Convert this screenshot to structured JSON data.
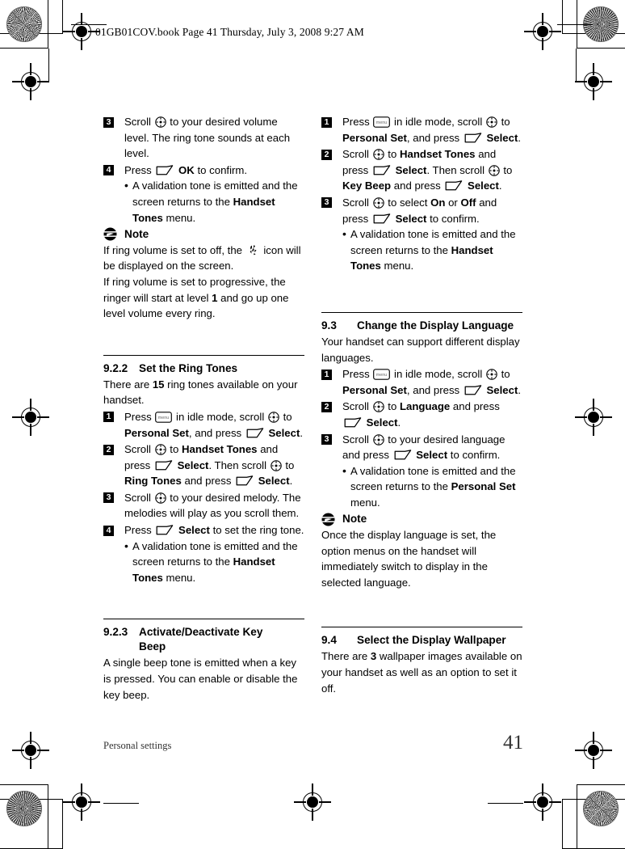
{
  "header": {
    "text": "01GB01COV.book  Page 41  Thursday, July 3, 2008  9:27 AM"
  },
  "footer": {
    "section_label": "Personal settings",
    "page_number": "41"
  },
  "icons": {
    "scroll": "scroll-wheel-icon",
    "softkey": "soft-key-icon",
    "menu_key": "menu-key-icon",
    "menu_key_label": "menu",
    "note": "note-icon",
    "ring_off": "ring-off-icon"
  },
  "left_column": {
    "steps_volume": [
      {
        "number": "3",
        "parts": [
          {
            "t": "text",
            "v": "Scroll "
          },
          {
            "t": "icon",
            "v": "scroll"
          },
          {
            "t": "text",
            "v": " to your desired volume level. The ring tone sounds at each level."
          }
        ]
      },
      {
        "number": "4",
        "parts": [
          {
            "t": "text",
            "v": "Press "
          },
          {
            "t": "icon",
            "v": "softkey"
          },
          {
            "t": "bold",
            "v": " OK"
          },
          {
            "t": "text",
            "v": " to confirm."
          }
        ]
      }
    ],
    "bullet_volume": [
      {
        "t": "text",
        "v": "A validation tone is emitted and the screen returns to the "
      },
      {
        "t": "bold",
        "v": "Handset Tones"
      },
      {
        "t": "text",
        "v": " menu."
      }
    ],
    "note": {
      "label": "Note",
      "line1_a": "If ring volume is set to off, the ",
      "line1_b": " icon will be displayed on the screen.",
      "line2_a": "If ring volume is set to progressive, the ringer will start at level ",
      "line2_b": "1",
      "line2_c": " and go up one level volume every ring."
    },
    "section_922": {
      "number": "9.2.2",
      "title": "Set the Ring Tones",
      "intro_a": "There are ",
      "intro_b": "15",
      "intro_c": " ring tones available on your handset.",
      "steps": [
        {
          "number": "1",
          "parts": [
            {
              "t": "text",
              "v": "Press "
            },
            {
              "t": "icon",
              "v": "menu_key"
            },
            {
              "t": "text",
              "v": " in idle mode, scroll "
            },
            {
              "t": "icon",
              "v": "scroll"
            },
            {
              "t": "text",
              "v": " to "
            },
            {
              "t": "bold",
              "v": "Personal Set"
            },
            {
              "t": "text",
              "v": ", and press "
            },
            {
              "t": "icon",
              "v": "softkey"
            },
            {
              "t": "bold",
              "v": " Select"
            },
            {
              "t": "text",
              "v": "."
            }
          ]
        },
        {
          "number": "2",
          "parts": [
            {
              "t": "text",
              "v": "Scroll "
            },
            {
              "t": "icon",
              "v": "scroll"
            },
            {
              "t": "text",
              "v": " to "
            },
            {
              "t": "bold",
              "v": "Handset Tones"
            },
            {
              "t": "text",
              "v": " and press "
            },
            {
              "t": "icon",
              "v": "softkey"
            },
            {
              "t": "bold",
              "v": " Select"
            },
            {
              "t": "text",
              "v": ". Then scroll "
            },
            {
              "t": "icon",
              "v": "scroll"
            },
            {
              "t": "text",
              "v": " to "
            },
            {
              "t": "bold",
              "v": "Ring Tones"
            },
            {
              "t": "text",
              "v": " and press "
            },
            {
              "t": "icon",
              "v": "softkey"
            },
            {
              "t": "bold",
              "v": " Select"
            },
            {
              "t": "text",
              "v": "."
            }
          ]
        },
        {
          "number": "3",
          "parts": [
            {
              "t": "text",
              "v": "Scroll "
            },
            {
              "t": "icon",
              "v": "scroll"
            },
            {
              "t": "text",
              "v": " to your desired melody. The melodies will play as you scroll them."
            }
          ]
        },
        {
          "number": "4",
          "parts": [
            {
              "t": "text",
              "v": "Press "
            },
            {
              "t": "icon",
              "v": "softkey"
            },
            {
              "t": "bold",
              "v": " Select"
            },
            {
              "t": "text",
              "v": " to set the ring tone."
            }
          ]
        }
      ],
      "bullet": [
        {
          "t": "text",
          "v": "A validation tone is emitted and the screen returns to the "
        },
        {
          "t": "bold",
          "v": "Handset Tones"
        },
        {
          "t": "text",
          "v": " menu."
        }
      ]
    },
    "section_923": {
      "number": "9.2.3",
      "title_line1": "Activate/Deactivate Key",
      "title_line2": "Beep",
      "body": "A single beep tone is emitted when a key is pressed. You can enable or disable the key beep."
    }
  },
  "right_column": {
    "steps_keybeep": [
      {
        "number": "1",
        "parts": [
          {
            "t": "text",
            "v": "Press "
          },
          {
            "t": "icon",
            "v": "menu_key"
          },
          {
            "t": "text",
            "v": " in idle mode, scroll "
          },
          {
            "t": "icon",
            "v": "scroll"
          },
          {
            "t": "text",
            "v": " to "
          },
          {
            "t": "bold",
            "v": "Personal Set"
          },
          {
            "t": "text",
            "v": ", and press "
          },
          {
            "t": "icon",
            "v": "softkey"
          },
          {
            "t": "bold",
            "v": " Select"
          },
          {
            "t": "text",
            "v": "."
          }
        ]
      },
      {
        "number": "2",
        "parts": [
          {
            "t": "text",
            "v": "Scroll "
          },
          {
            "t": "icon",
            "v": "scroll"
          },
          {
            "t": "text",
            "v": " to "
          },
          {
            "t": "bold",
            "v": "Handset Tones"
          },
          {
            "t": "text",
            "v": " and press "
          },
          {
            "t": "icon",
            "v": "softkey"
          },
          {
            "t": "bold",
            "v": " Select"
          },
          {
            "t": "text",
            "v": ". Then scroll "
          },
          {
            "t": "icon",
            "v": "scroll"
          },
          {
            "t": "text",
            "v": " to "
          },
          {
            "t": "bold",
            "v": "Key Beep"
          },
          {
            "t": "text",
            "v": " and press "
          },
          {
            "t": "icon",
            "v": "softkey"
          },
          {
            "t": "bold",
            "v": " Select"
          },
          {
            "t": "text",
            "v": "."
          }
        ]
      },
      {
        "number": "3",
        "parts": [
          {
            "t": "text",
            "v": "Scroll "
          },
          {
            "t": "icon",
            "v": "scroll"
          },
          {
            "t": "text",
            "v": " to select "
          },
          {
            "t": "bold",
            "v": "On"
          },
          {
            "t": "text",
            "v": " or "
          },
          {
            "t": "bold",
            "v": "Off"
          },
          {
            "t": "text",
            "v": " and press "
          },
          {
            "t": "icon",
            "v": "softkey"
          },
          {
            "t": "bold",
            "v": " Select"
          },
          {
            "t": "text",
            "v": " to confirm."
          }
        ]
      }
    ],
    "bullet_keybeep": [
      {
        "t": "text",
        "v": "A validation tone is emitted and the screen returns to the "
      },
      {
        "t": "bold",
        "v": "Handset Tones"
      },
      {
        "t": "text",
        "v": " menu."
      }
    ],
    "section_93": {
      "number": "9.3",
      "title": "Change the Display Language",
      "intro": "Your handset can support different display languages.",
      "steps": [
        {
          "number": "1",
          "parts": [
            {
              "t": "text",
              "v": "Press "
            },
            {
              "t": "icon",
              "v": "menu_key"
            },
            {
              "t": "text",
              "v": " in idle mode, scroll "
            },
            {
              "t": "icon",
              "v": "scroll"
            },
            {
              "t": "text",
              "v": " to "
            },
            {
              "t": "bold",
              "v": "Personal Set"
            },
            {
              "t": "text",
              "v": ", and press "
            },
            {
              "t": "icon",
              "v": "softkey"
            },
            {
              "t": "bold",
              "v": " Select"
            },
            {
              "t": "text",
              "v": "."
            }
          ]
        },
        {
          "number": "2",
          "parts": [
            {
              "t": "text",
              "v": "Scroll "
            },
            {
              "t": "icon",
              "v": "scroll"
            },
            {
              "t": "text",
              "v": " to "
            },
            {
              "t": "bold",
              "v": "Language"
            },
            {
              "t": "text",
              "v": " and press "
            },
            {
              "t": "icon",
              "v": "softkey"
            },
            {
              "t": "bold",
              "v": " Select"
            },
            {
              "t": "text",
              "v": "."
            }
          ]
        },
        {
          "number": "3",
          "parts": [
            {
              "t": "text",
              "v": "Scroll "
            },
            {
              "t": "icon",
              "v": "scroll"
            },
            {
              "t": "text",
              "v": " to your desired language and press "
            },
            {
              "t": "icon",
              "v": "softkey"
            },
            {
              "t": "bold",
              "v": " Select"
            },
            {
              "t": "text",
              "v": " to confirm."
            }
          ]
        }
      ],
      "bullet": [
        {
          "t": "text",
          "v": "A validation tone is emitted and the screen returns to the "
        },
        {
          "t": "bold",
          "v": "Personal Set"
        },
        {
          "t": "text",
          "v": " menu."
        }
      ],
      "note": {
        "label": "Note",
        "body": "Once the display language is set, the option menus on the handset will immediately switch to display in the selected language."
      }
    },
    "section_94": {
      "number": "9.4",
      "title": "Select the Display Wallpaper",
      "body_a": "There are ",
      "body_b": "3",
      "body_c": " wallpaper images available on your handset as well as an option to set it off."
    }
  }
}
